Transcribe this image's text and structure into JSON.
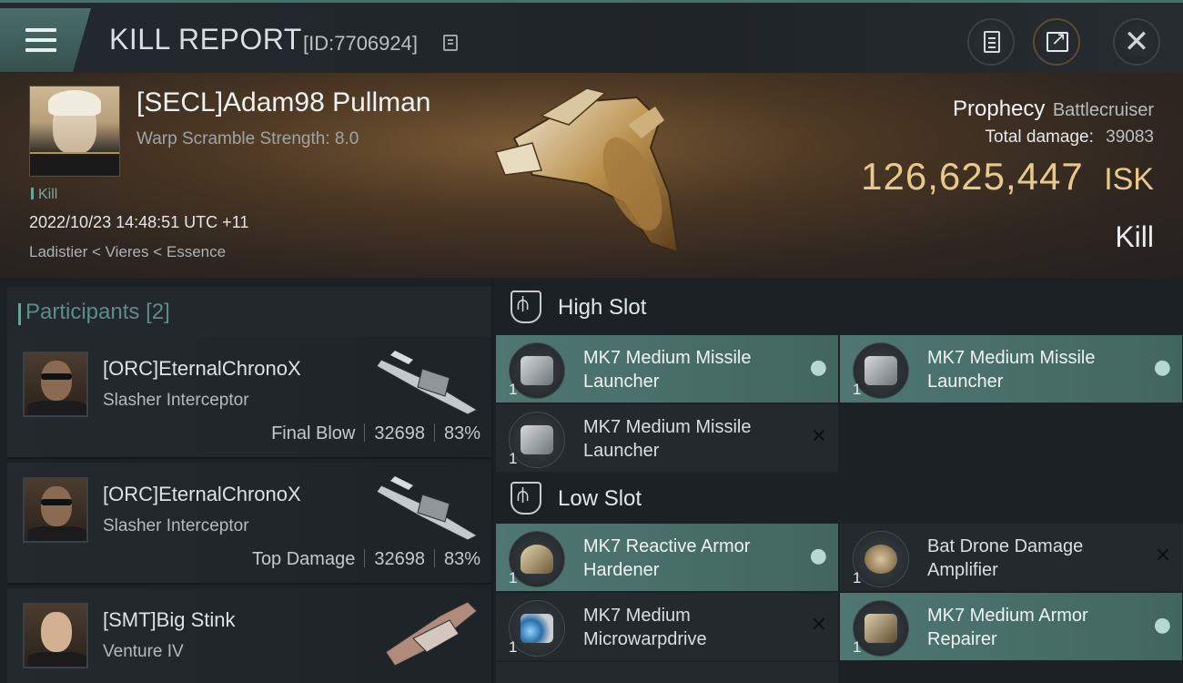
{
  "header": {
    "title": "KILL REPORT",
    "id_label": "[ID:7706924]"
  },
  "victim": {
    "name": "[SECL]Adam98 Pullman",
    "warp_scramble": "Warp Scramble Strength: 8.0",
    "tag": "Kill",
    "datetime": "2022/10/23 14:48:51 UTC +11",
    "location": "Ladistier < Vieres < Essence",
    "ship_name": "Prophecy",
    "ship_class": "Battlecruiser",
    "total_damage_label": "Total damage:",
    "total_damage": "39083",
    "isk_value": "126,625,447",
    "isk_unit": "ISK",
    "result": "Kill"
  },
  "participants": {
    "title": "Participants",
    "count": "[2]",
    "rows": [
      {
        "name": "[ORC]EternalChronoX",
        "ship": "Slasher Interceptor",
        "role": "Final Blow",
        "damage": "32698",
        "percent": "83%"
      },
      {
        "name": "[ORC]EternalChronoX",
        "ship": "Slasher Interceptor",
        "role": "Top Damage",
        "damage": "32698",
        "percent": "83%"
      },
      {
        "name": "[SMT]Big Stink",
        "ship": "Venture IV"
      }
    ]
  },
  "slots": {
    "high": {
      "title": "High Slot",
      "modules": [
        {
          "name": "MK7 Medium Missile Launcher",
          "qty": "1",
          "status": "dropped",
          "icon": "missile-launcher-icon"
        },
        {
          "name": "MK7 Medium Missile Launcher",
          "qty": "1",
          "status": "dropped",
          "icon": "missile-launcher-icon"
        },
        {
          "name": "MK7 Medium Missile Launcher",
          "qty": "1",
          "status": "destroyed",
          "icon": "missile-launcher-icon"
        }
      ]
    },
    "low": {
      "title": "Low Slot",
      "modules": [
        {
          "name": "MK7 Reactive Armor Hardener",
          "qty": "1",
          "status": "dropped",
          "icon": "armor-hardener-icon"
        },
        {
          "name": "Bat Drone Damage Amplifier",
          "qty": "1",
          "status": "destroyed",
          "icon": "drone-amplifier-icon"
        },
        {
          "name": "MK7 Medium Microwarpdrive",
          "qty": "1",
          "status": "destroyed",
          "icon": "microwarpdrive-icon"
        },
        {
          "name": "MK7 Medium Armor Repairer",
          "qty": "1",
          "status": "dropped",
          "icon": "armor-repairer-icon"
        }
      ]
    }
  },
  "colors": {
    "accent": "#4e7772",
    "isk": "#e8c98a",
    "participants_title": "#5d8d88"
  }
}
